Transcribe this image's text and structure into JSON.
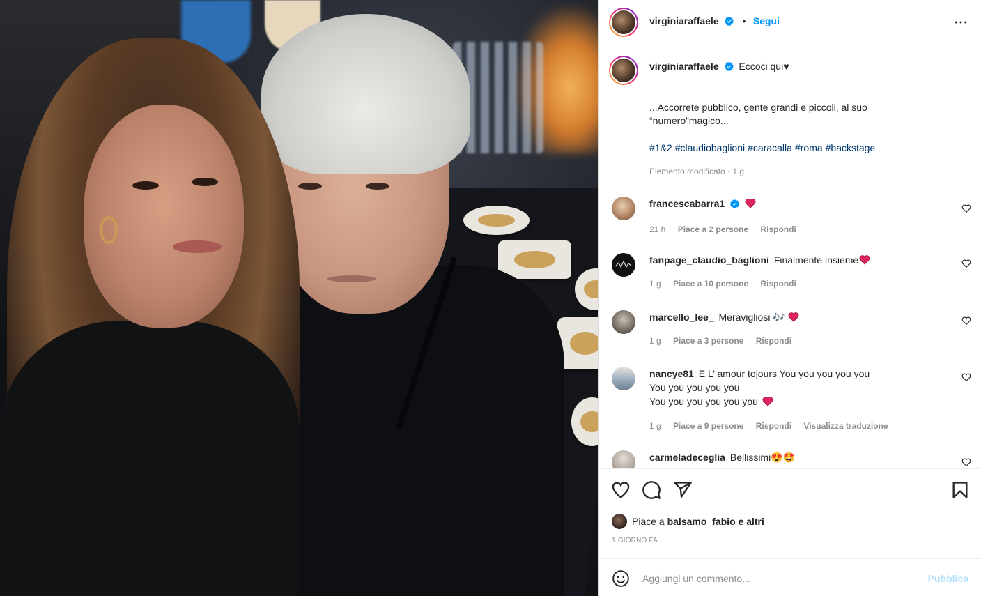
{
  "post": {
    "author": "virginiaraffaele",
    "follow_label": "Segui",
    "separator": "•",
    "caption_first": "Eccoci qui♥",
    "caption_line1": "...Accorrete pubblico, gente grandi e piccoli, al suo",
    "caption_line2": "“numero”magico...",
    "hashtags": [
      "#1&2",
      "#claudiobaglioni",
      "#caracalla",
      "#roma",
      "#backstage"
    ],
    "edited": "Elemento modificato · 1 g"
  },
  "comments": [
    {
      "user": "francescabarra1",
      "text": "",
      "time": "21 h",
      "likes": "Piace a 2 persone",
      "reply": "Rispondi",
      "translate": ""
    },
    {
      "user": "fanpage_claudio_baglioni",
      "text": "Finalmente insieme",
      "time": "1 g",
      "likes": "Piace a 10 persone",
      "reply": "Rispondi",
      "translate": ""
    },
    {
      "user": "marcello_lee_",
      "text": "Meravigliosi 🎶",
      "time": "1 g",
      "likes": "Piace a 3 persone",
      "reply": "Rispondi",
      "translate": ""
    },
    {
      "user": "nancye81",
      "text": "E L’ amour tojours You you you you you",
      "text2": "You you you you you",
      "text3": "You you you you you you",
      "time": "1 g",
      "likes": "Piace a 9 persone",
      "reply": "Rispondi",
      "translate": "Visualizza traduzione"
    },
    {
      "user": "carmeladeceglia",
      "text": "Bellissimi😍🤩"
    }
  ],
  "actions": {
    "likes_prefix": "Piace a",
    "likes_user": "balsamo_fabio",
    "likes_suffix": "e altri",
    "date": "1 GIORNO FA"
  },
  "composer": {
    "placeholder": "Aggiungi un commento...",
    "publish_label": "Pubblica"
  },
  "colors": {
    "link": "#0095f6",
    "hashtag": "#00376b",
    "muted": "#8e8e8e",
    "heart": "#ed4956"
  },
  "icons": [
    "verified-badge-icon",
    "more-options-icon",
    "heart-outline-icon",
    "comment-icon",
    "share-icon",
    "bookmark-icon",
    "emoji-icon",
    "red-heart-emoji"
  ]
}
